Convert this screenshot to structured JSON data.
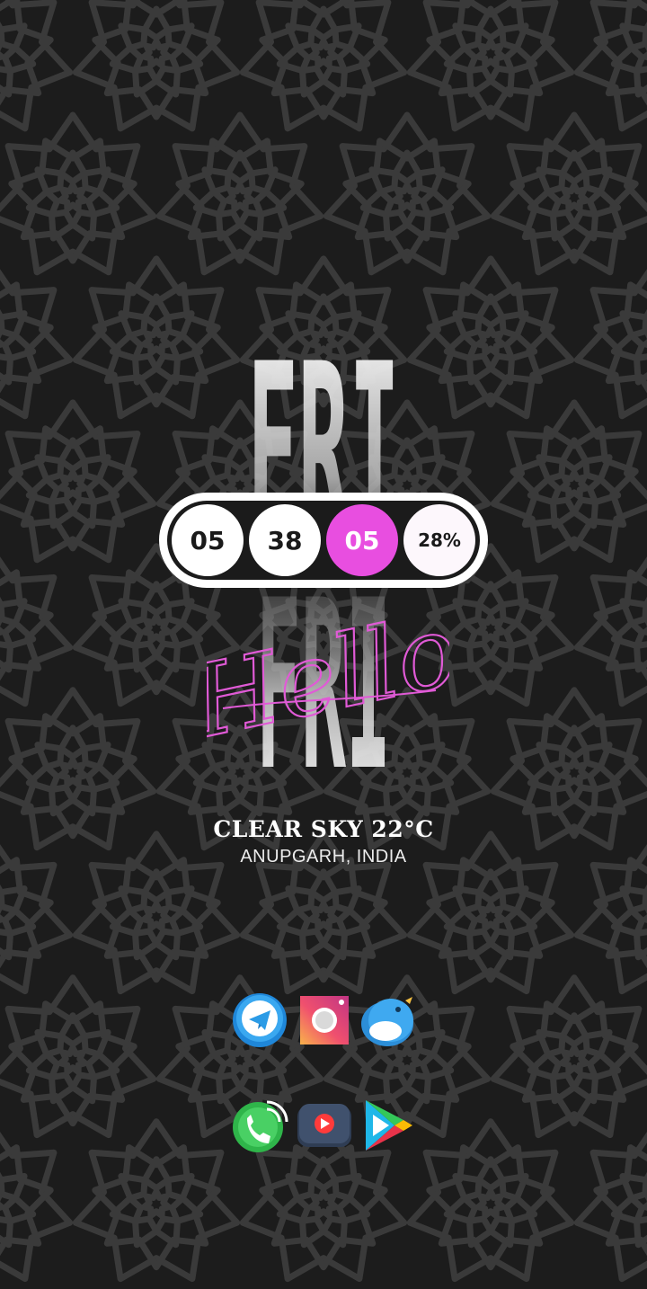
{
  "wallpaper": {
    "pattern": "star-kaleidoscope",
    "bg_color": "#1c1c1c",
    "line_color": "#3a3a3a"
  },
  "widget": {
    "day_abbrev": "FRI",
    "greeting": "Hello",
    "hour": "05",
    "minute": "38",
    "second": "05",
    "battery": "28%",
    "accent_color": "#e84ee0"
  },
  "weather": {
    "condition": "CLEAR SKY 22°C",
    "location": "ANUPGARH, INDIA"
  },
  "dock": {
    "row1": [
      {
        "app": "telegram",
        "icon": "telegram-icon"
      },
      {
        "app": "instagram",
        "icon": "instagram-icon"
      },
      {
        "app": "twitter",
        "icon": "twitter-bird-icon"
      }
    ],
    "row2": [
      {
        "app": "phone",
        "icon": "phone-icon"
      },
      {
        "app": "youtube",
        "icon": "youtube-icon"
      },
      {
        "app": "play-store",
        "icon": "play-store-icon"
      }
    ]
  }
}
